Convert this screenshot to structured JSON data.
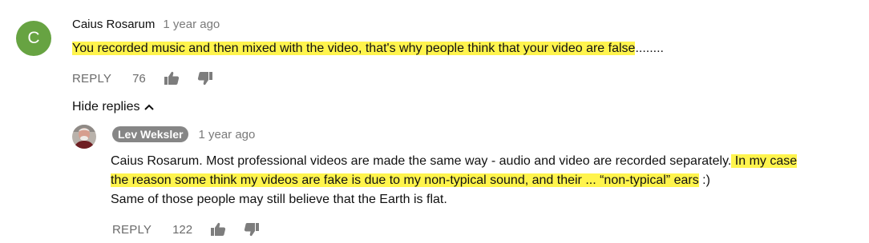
{
  "comment": {
    "avatar_letter": "C",
    "avatar_color": "#67a342",
    "author": "Caius Rosarum",
    "time": "1 year ago",
    "text_highlighted": "You recorded music and then mixed with the video, that's why people think that your video are false",
    "text_tail": "........",
    "reply_label": "REPLY",
    "likes": "76"
  },
  "hide_replies_label": "Hide replies",
  "reply": {
    "author": "Lev Weksler",
    "time": "1 year ago",
    "line1_plain": "Caius Rosarum. Most professional videos are made the same way - audio and video are recorded separately.",
    "line1_highlighted": " In my case",
    "line2_highlighted": "the reason some think my videos are fake is due to my non-typical sound, and their ... “non-typical” ears",
    "line2_tail": "  :)",
    "line3": " Same of those people may still believe that the Earth is flat.",
    "reply_label": "REPLY",
    "likes": "122"
  },
  "colors": {
    "highlight": "#fff44d",
    "meta_gray": "#6b6b6b",
    "author_chip": "#868686"
  },
  "icons": [
    "thumb-up-icon",
    "thumb-down-icon",
    "chevron-up-icon"
  ]
}
